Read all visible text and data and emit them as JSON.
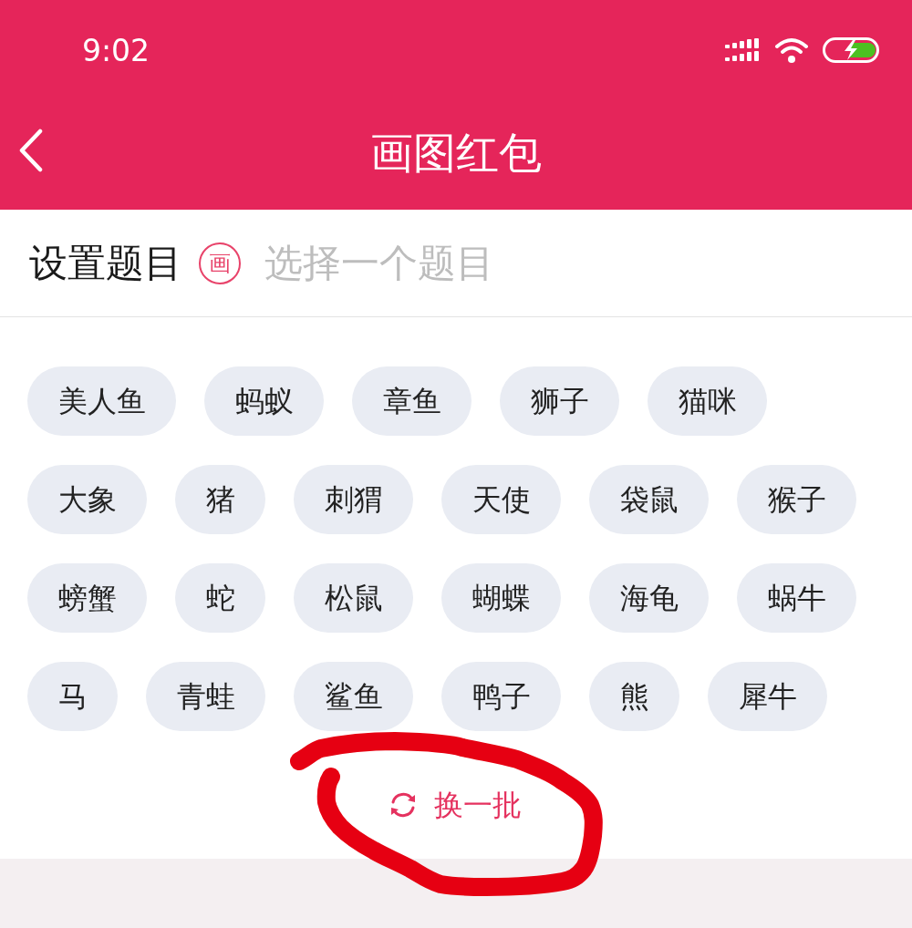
{
  "status_bar": {
    "time": "9:02"
  },
  "header": {
    "title": "画图红包"
  },
  "topic_row": {
    "label": "设置题目",
    "badge": "画",
    "placeholder": "选择一个题目"
  },
  "topics": [
    {
      "label": "美人鱼",
      "selected": false
    },
    {
      "label": "蚂蚁",
      "selected": false
    },
    {
      "label": "章鱼",
      "selected": false
    },
    {
      "label": "狮子",
      "selected": false
    },
    {
      "label": "猫咪",
      "selected": false
    },
    {
      "label": "大象",
      "selected": false
    },
    {
      "label": "猪",
      "selected": false
    },
    {
      "label": "刺猬",
      "selected": false
    },
    {
      "label": "天使",
      "selected": false
    },
    {
      "label": "袋鼠",
      "selected": false
    },
    {
      "label": "猴子",
      "selected": false
    },
    {
      "label": "螃蟹",
      "selected": false
    },
    {
      "label": "蛇",
      "selected": false
    },
    {
      "label": "松鼠",
      "selected": false
    },
    {
      "label": "蝴蝶",
      "selected": false
    },
    {
      "label": "海龟",
      "selected": false
    },
    {
      "label": "蜗牛",
      "selected": false
    },
    {
      "label": "马",
      "selected": false
    },
    {
      "label": "青蛙",
      "selected": false
    },
    {
      "label": "鲨鱼",
      "selected": false
    },
    {
      "label": "鸭子",
      "selected": false
    },
    {
      "label": "熊",
      "selected": false
    },
    {
      "label": "犀牛",
      "selected": false
    }
  ],
  "refresh_button": {
    "label": "换一批"
  }
}
